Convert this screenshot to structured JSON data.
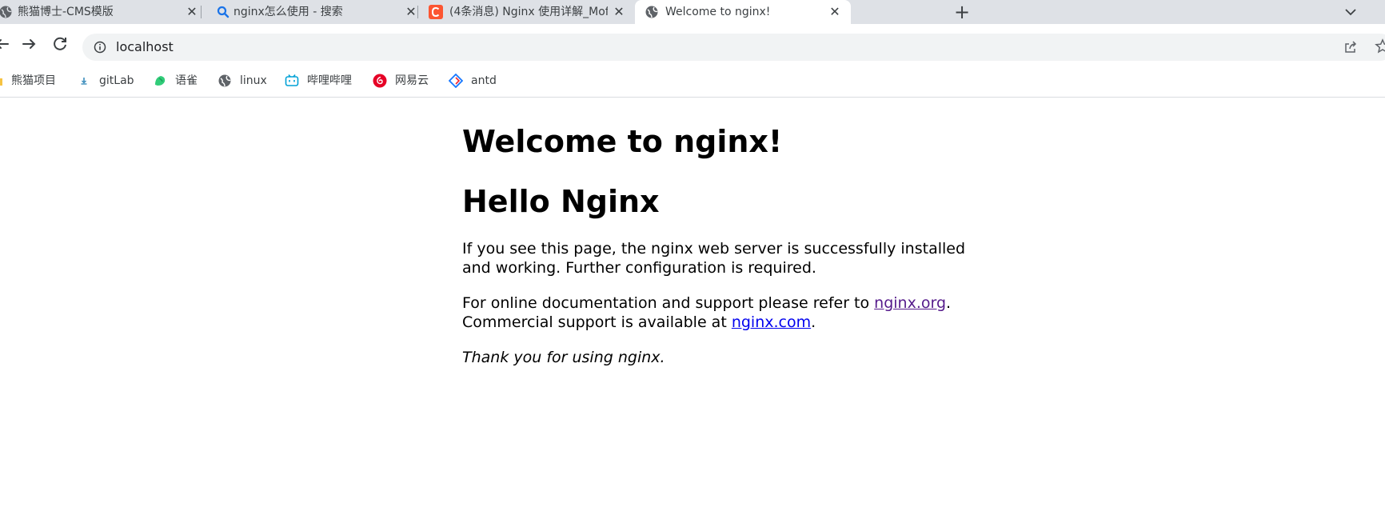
{
  "tabs": [
    {
      "title": "熊猫博士-CMS模版",
      "active": false
    },
    {
      "title": "nginx怎么使用 - 搜索",
      "active": false
    },
    {
      "title": "(4条消息) Nginx 使用详解_Mof_",
      "active": false
    },
    {
      "title": "Welcome to nginx!",
      "active": true
    }
  ],
  "new_tab_label": "+",
  "toolbar": {
    "url": "localhost"
  },
  "bookmarks": [
    {
      "label": "熊猫项目",
      "icon": "folder-icon"
    },
    {
      "label": "gitLab",
      "icon": "gitlab-icon"
    },
    {
      "label": "语雀",
      "icon": "yuque-icon"
    },
    {
      "label": "linux",
      "icon": "globe-icon"
    },
    {
      "label": "哔哩哔哩",
      "icon": "bilibili-icon"
    },
    {
      "label": "网易云",
      "icon": "netease-music-icon"
    },
    {
      "label": "antd",
      "icon": "antd-icon"
    }
  ],
  "page": {
    "heading": "Welcome to nginx!",
    "heading2": "Hello Nginx",
    "para1": "If you see this page, the nginx web server is successfully installed and working. Further configuration is required.",
    "para2_prefix": "For online documentation and support please refer to ",
    "link1": "nginx.org",
    "para2_mid": ".",
    "para2_line2": "Commercial support is available at ",
    "link2": "nginx.com",
    "para2_end": ".",
    "para3": "Thank you for using nginx."
  },
  "colors": {
    "tabstrip_bg": "#dee1e6",
    "omnibox_bg": "#f1f3f4",
    "link": "#0000ee",
    "link_visited": "#551a8b",
    "csdn_red": "#fc5531"
  }
}
